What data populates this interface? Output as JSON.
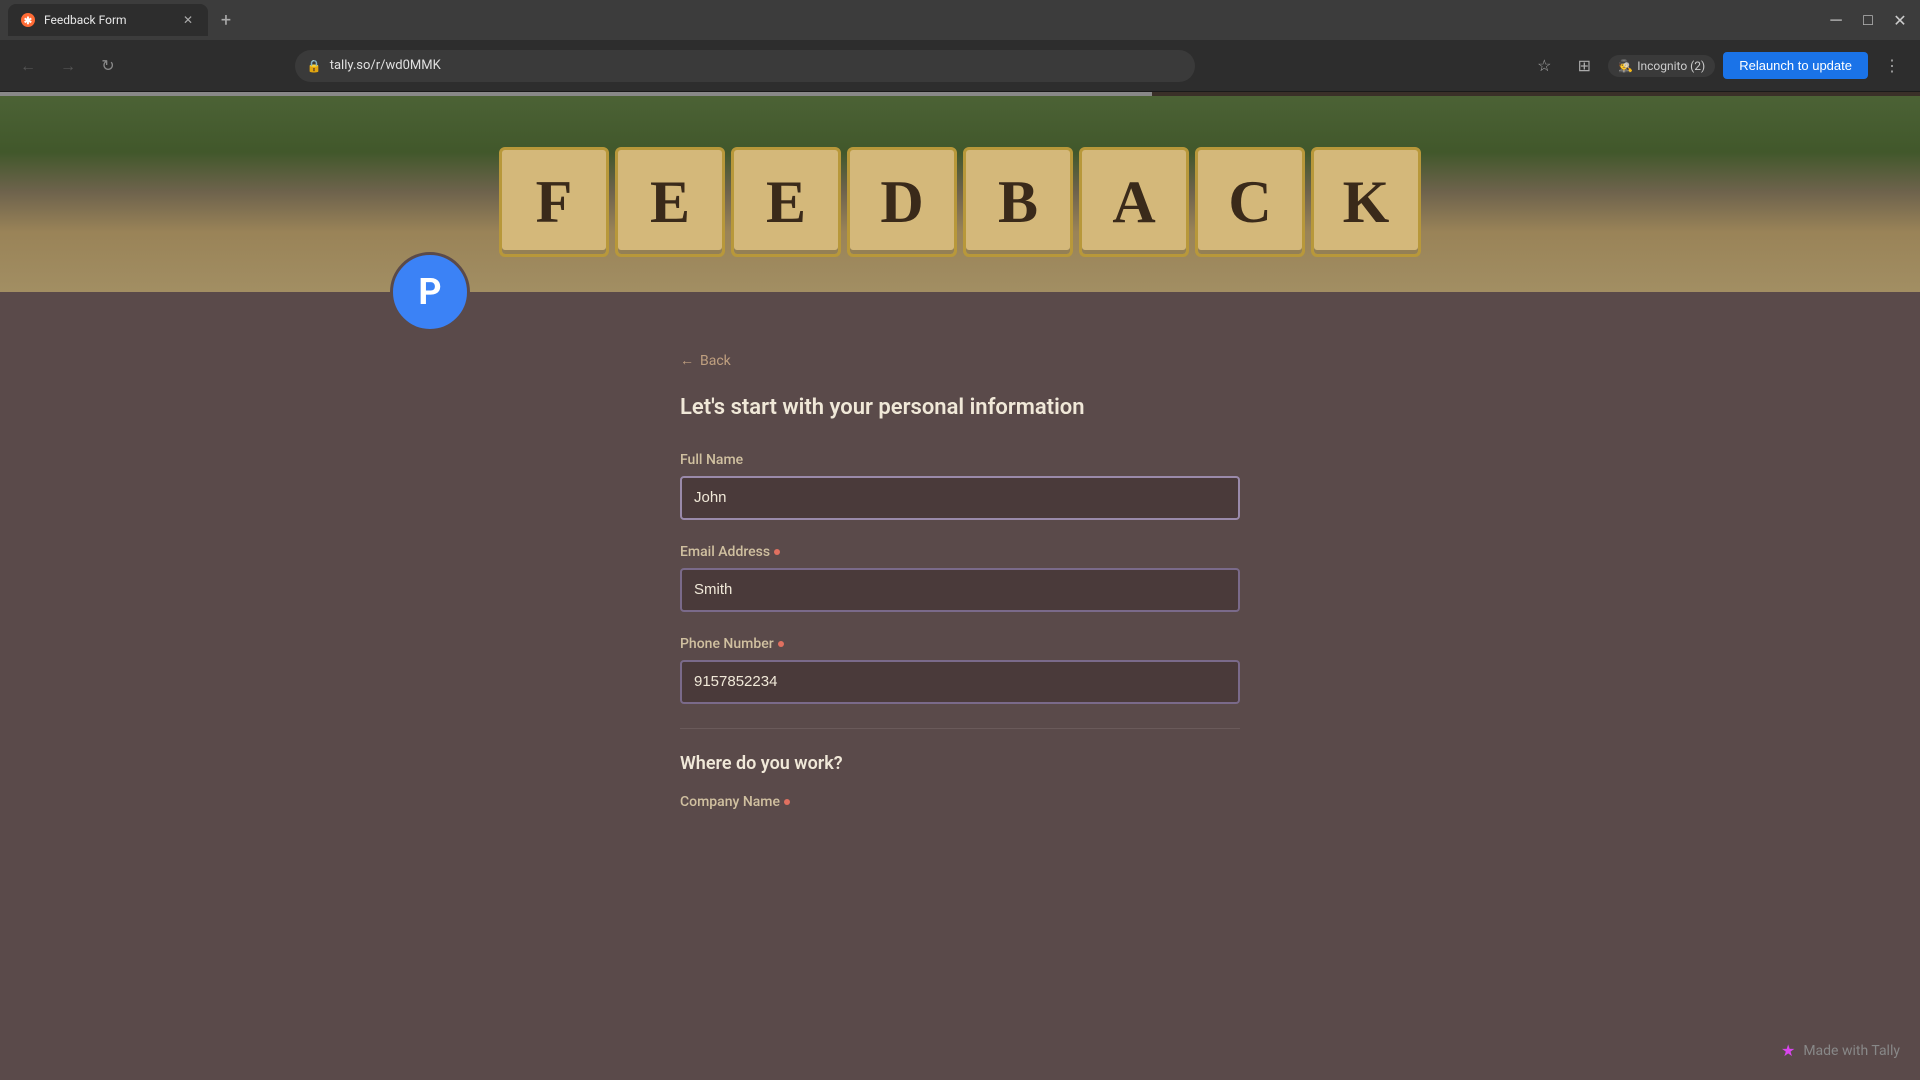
{
  "browser": {
    "tab": {
      "title": "Feedback Form",
      "favicon": "✱"
    },
    "url": "tally.so/r/wd0MMK",
    "incognito_label": "Incognito (2)",
    "relaunch_label": "Relaunch to update",
    "new_tab_symbol": "+"
  },
  "page": {
    "avatar_letter": "P",
    "back_label": "Back",
    "section_title": "Let's start with your personal information",
    "fields": {
      "full_name": {
        "label": "Full Name",
        "value": "John",
        "required": false
      },
      "email": {
        "label": "Email Address",
        "value": "Smith",
        "required": true
      },
      "phone": {
        "label": "Phone Number",
        "value": "9157852234",
        "required": true
      }
    },
    "work_section": {
      "title": "Where do you work?",
      "company_field": {
        "label": "Company Name",
        "required": true
      }
    }
  },
  "footer": {
    "made_with_label": "Made with Tally"
  },
  "hero": {
    "text": "FEEDBACK"
  }
}
